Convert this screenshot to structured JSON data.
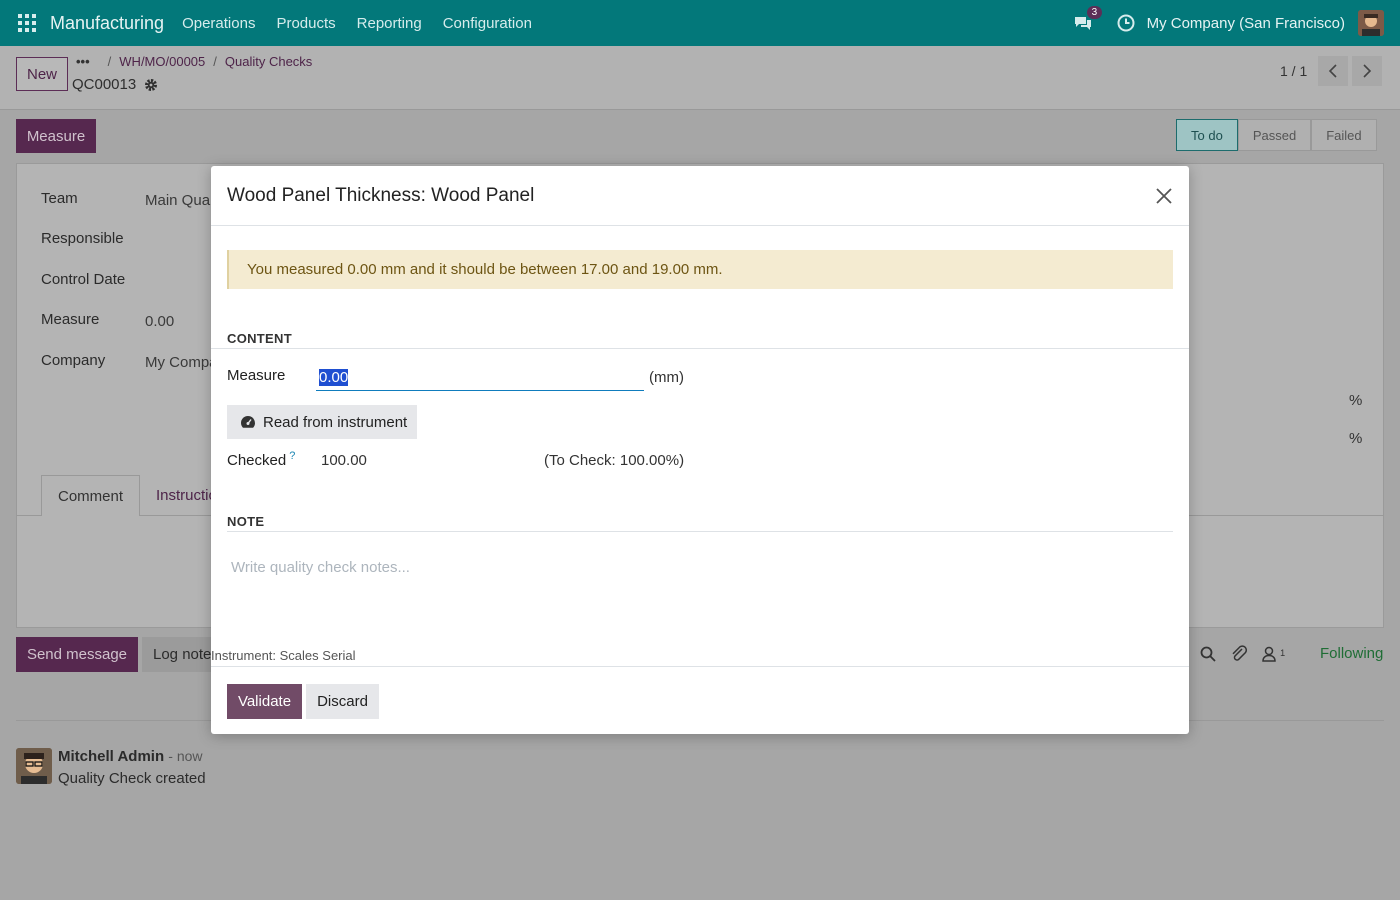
{
  "navbar": {
    "app_name": "Manufacturing",
    "menu": [
      "Operations",
      "Products",
      "Reporting",
      "Configuration"
    ],
    "chat_badge": "3",
    "company": "My Company (San Francisco)",
    "colors": {
      "bar": "#017e84"
    }
  },
  "control_panel": {
    "new_label": "New",
    "breadcrumb": {
      "dots": "•••",
      "sep": "/",
      "parent": "WH/MO/00005",
      "current": "Quality Checks"
    },
    "record_name": "QC00013",
    "pager": "1 / 1"
  },
  "form": {
    "measure_button": "Measure",
    "stages": [
      "To do",
      "Passed",
      "Failed"
    ],
    "fields": {
      "team_label": "Team",
      "team_value": "Main Qua",
      "responsible_label": "Responsible",
      "control_date_label": "Control Date",
      "measure_label": "Measure",
      "measure_value": "0.00",
      "company_label": "Company",
      "company_value": "My Compa"
    },
    "percent": "%",
    "tabs": [
      "Comment",
      "Instructio"
    ]
  },
  "chatter": {
    "send_message": "Send message",
    "log_note": "Log note",
    "follower_count": "1",
    "following": "Following",
    "message": {
      "author": "Mitchell Admin",
      "time": "- now",
      "body": "Quality Check created"
    }
  },
  "modal": {
    "title": "Wood Panel Thickness: Wood Panel",
    "alert": "You measured 0.00 mm and it should be between 17.00 and 19.00 mm.",
    "content_section": "CONTENT",
    "measure_label": "Measure",
    "measure_value": "0.00",
    "unit": "(mm)",
    "read_button": "Read from instrument",
    "checked_label": "Checked",
    "checked_help": "?",
    "checked_value": "100.00",
    "to_check": "(To Check: 100.00%)",
    "note_section": "NOTE",
    "note_placeholder": "Write quality check notes...",
    "instrument": "Instrument: Scales Serial",
    "validate": "Validate",
    "discard": "Discard",
    "colors": {
      "primary": "#714b67",
      "alert_bg": "#f4ebd1"
    }
  }
}
